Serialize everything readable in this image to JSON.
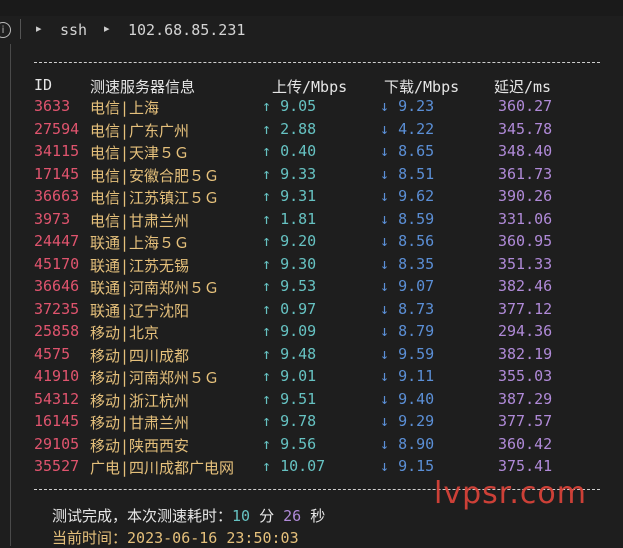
{
  "breadcrumb": {
    "items": [
      "ssh",
      "102.68.85.231"
    ]
  },
  "table": {
    "headers": [
      "ID",
      "测速服务器信息",
      "上传/Mbps",
      "下载/Mbps",
      "延迟/ms"
    ],
    "rows": [
      {
        "id": "3633",
        "server": "电信|上海",
        "up": "9.05",
        "down": "9.23",
        "latency": "360.27"
      },
      {
        "id": "27594",
        "server": "电信|广东广州",
        "up": "2.88",
        "down": "4.22",
        "latency": "345.78"
      },
      {
        "id": "34115",
        "server": "电信|天津５Ｇ",
        "up": "0.40",
        "down": "8.65",
        "latency": "348.40"
      },
      {
        "id": "17145",
        "server": "电信|安徽合肥５Ｇ",
        "up": "9.33",
        "down": "8.51",
        "latency": "361.73"
      },
      {
        "id": "36663",
        "server": "电信|江苏镇江５Ｇ",
        "up": "9.31",
        "down": "9.62",
        "latency": "390.26"
      },
      {
        "id": "3973",
        "server": "电信|甘肃兰州",
        "up": "1.81",
        "down": "8.59",
        "latency": "331.06"
      },
      {
        "id": "24447",
        "server": "联通|上海５Ｇ",
        "up": "9.20",
        "down": "8.56",
        "latency": "360.95"
      },
      {
        "id": "45170",
        "server": "联通|江苏无锡",
        "up": "9.30",
        "down": "8.35",
        "latency": "351.33"
      },
      {
        "id": "36646",
        "server": "联通|河南郑州５Ｇ",
        "up": "9.53",
        "down": "9.07",
        "latency": "382.46"
      },
      {
        "id": "37235",
        "server": "联通|辽宁沈阳",
        "up": "0.97",
        "down": "8.73",
        "latency": "377.12"
      },
      {
        "id": "25858",
        "server": "移动|北京",
        "up": "9.09",
        "down": "8.79",
        "latency": "294.36"
      },
      {
        "id": "4575",
        "server": "移动|四川成都",
        "up": "9.48",
        "down": "9.59",
        "latency": "382.19"
      },
      {
        "id": "41910",
        "server": "移动|河南郑州５Ｇ",
        "up": "9.01",
        "down": "9.11",
        "latency": "355.03"
      },
      {
        "id": "54312",
        "server": "移动|浙江杭州",
        "up": "9.51",
        "down": "9.40",
        "latency": "387.29"
      },
      {
        "id": "16145",
        "server": "移动|甘肃兰州",
        "up": "9.78",
        "down": "9.29",
        "latency": "377.57"
      },
      {
        "id": "29105",
        "server": "移动|陕西西安",
        "up": "9.56",
        "down": "8.90",
        "latency": "360.42"
      },
      {
        "id": "35527",
        "server": "广电|四川成都广电网",
        "up": "10.07",
        "down": "9.15",
        "latency": "375.41"
      }
    ]
  },
  "footer": {
    "done_label": "测试完成，本次测速耗时：",
    "minutes": "10",
    "minutes_unit": "分",
    "seconds": "26",
    "seconds_unit": "秒",
    "time_label": "当前时间：",
    "time_value": "2023-06-16 23:50:03"
  },
  "arrows": {
    "up": "↑",
    "down": "↓"
  },
  "watermark": "lvpsr.com",
  "colors": {
    "background": "#1e1e1e",
    "id": "#e0546e",
    "server": "#e5c07b",
    "upload": "#66c2c2",
    "download": "#5b8fd6",
    "latency": "#b08ad8",
    "watermark": "#e0443a"
  }
}
